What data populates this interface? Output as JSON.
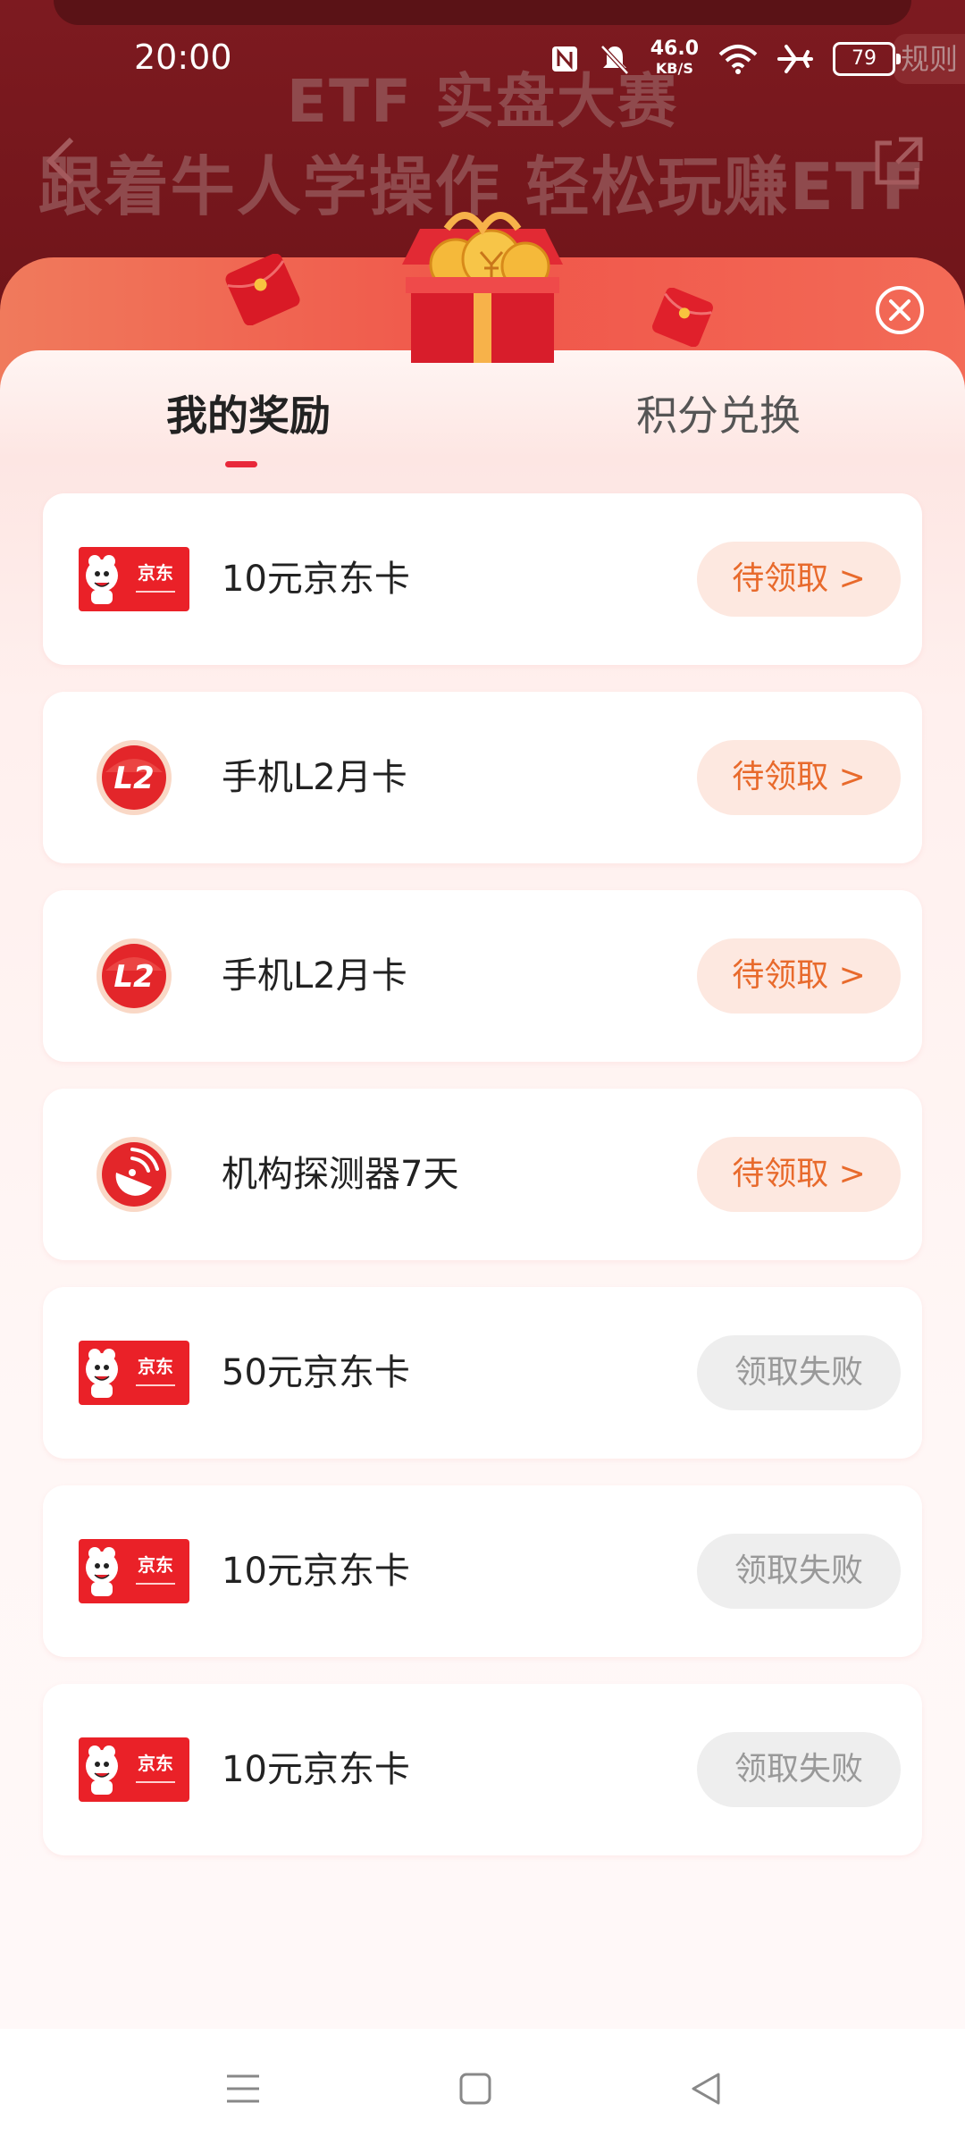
{
  "status_bar": {
    "time": "20:00",
    "speed_value": "46.0",
    "speed_unit": "KB/S",
    "battery": "79"
  },
  "background_page": {
    "rules_label": "规则",
    "title_line1": "ETF 实盘大赛",
    "title_line2": "跟着牛人学操作 轻松玩赚ETF"
  },
  "tabs": [
    {
      "label": "我的奖励",
      "active": true
    },
    {
      "label": "积分兑换",
      "active": false
    }
  ],
  "rewards": [
    {
      "icon": "jd-card-icon",
      "name": "10元京东卡",
      "status": "待领取 >",
      "state": "pending"
    },
    {
      "icon": "l2-badge-icon",
      "name": "手机L2月卡",
      "status": "待领取 >",
      "state": "pending"
    },
    {
      "icon": "l2-badge-icon",
      "name": "手机L2月卡",
      "status": "待领取 >",
      "state": "pending"
    },
    {
      "icon": "radar-detector-icon",
      "name": "机构探测器7天",
      "status": "待领取 >",
      "state": "pending"
    },
    {
      "icon": "jd-card-icon",
      "name": "50元京东卡",
      "status": "领取失败",
      "state": "failed"
    },
    {
      "icon": "jd-card-icon",
      "name": "10元京东卡",
      "status": "领取失败",
      "state": "failed"
    },
    {
      "icon": "jd-card-icon",
      "name": "10元京东卡",
      "status": "领取失败",
      "state": "failed"
    }
  ],
  "jd_card_text": "京东",
  "l2_text": "L2",
  "colors": {
    "accent": "#e8283a",
    "pending_text": "#e86a2c",
    "pending_bg": "#fde8e0",
    "failed_bg": "#eeeeee"
  }
}
